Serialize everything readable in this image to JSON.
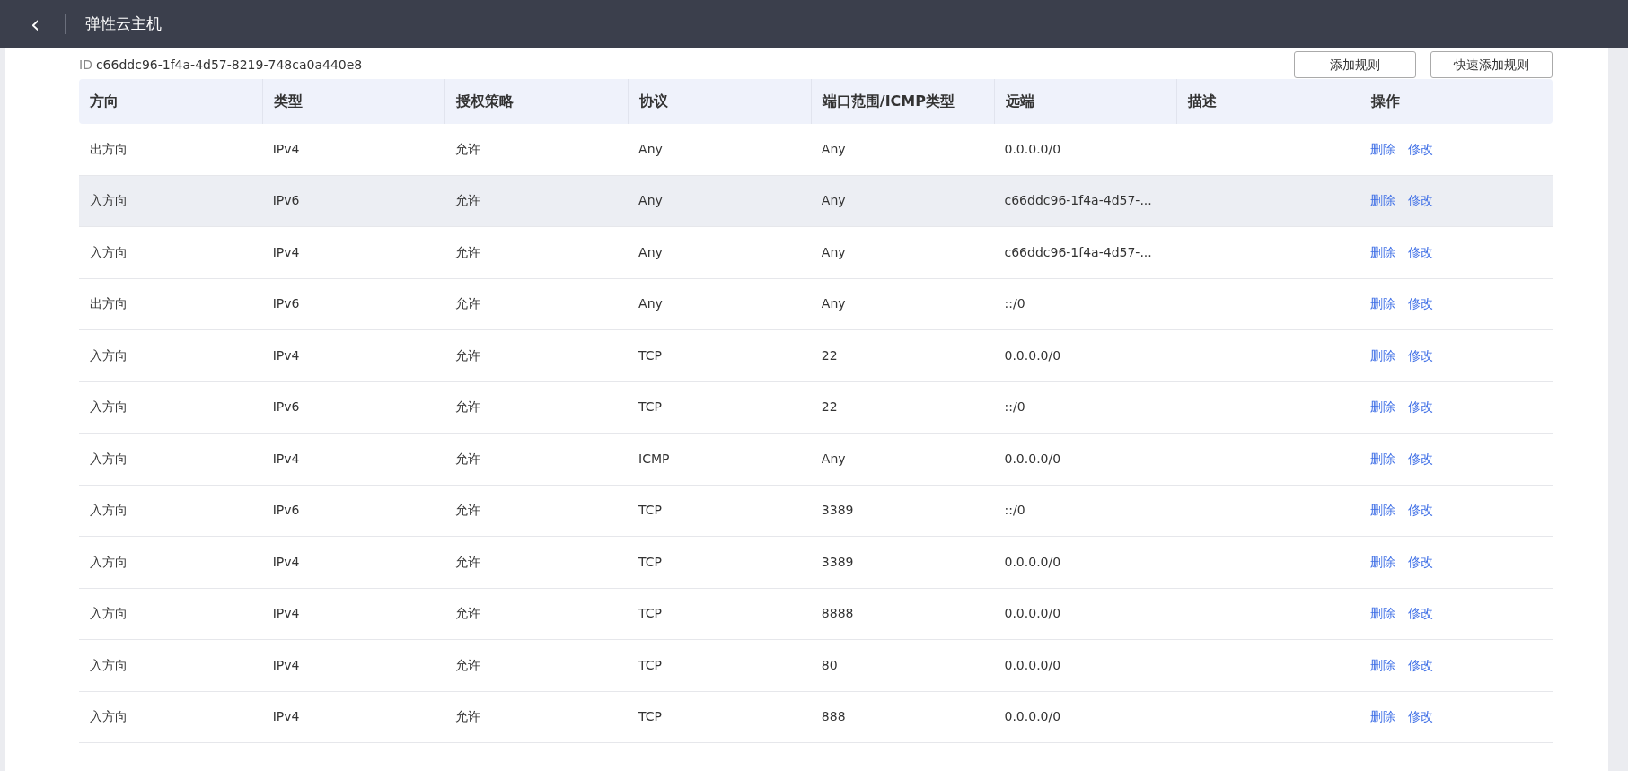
{
  "header": {
    "back": "‹",
    "title": "弹性云主机"
  },
  "id": {
    "label": "ID",
    "value": "c66ddc96-1f4a-4d57-8219-748ca0a440e8"
  },
  "buttons": [
    "添加规则",
    "快速添加规则"
  ],
  "table": {
    "columns": [
      "方向",
      "类型",
      "授权策略",
      "协议",
      "端口范围/ICMP类型",
      "远端",
      "描述",
      "操作"
    ],
    "rows": [
      {
        "cells": [
          "出方向",
          "IPv4",
          "允许",
          "Any",
          "Any",
          "0.0.0.0/0",
          ""
        ],
        "actions": [
          "删除",
          "修改"
        ],
        "highlighted": false
      },
      {
        "cells": [
          "入方向",
          "IPv6",
          "允许",
          "Any",
          "Any",
          "c66ddc96-1f4a-4d57-...",
          ""
        ],
        "actions": [
          "删除",
          "修改"
        ],
        "highlighted": true
      },
      {
        "cells": [
          "入方向",
          "IPv4",
          "允许",
          "Any",
          "Any",
          "c66ddc96-1f4a-4d57-...",
          ""
        ],
        "actions": [
          "删除",
          "修改"
        ],
        "highlighted": false
      },
      {
        "cells": [
          "出方向",
          "IPv6",
          "允许",
          "Any",
          "Any",
          "::/0",
          ""
        ],
        "actions": [
          "删除",
          "修改"
        ],
        "highlighted": false
      },
      {
        "cells": [
          "入方向",
          "IPv4",
          "允许",
          "TCP",
          "22",
          "0.0.0.0/0",
          ""
        ],
        "actions": [
          "删除",
          "修改"
        ],
        "highlighted": false
      },
      {
        "cells": [
          "入方向",
          "IPv6",
          "允许",
          "TCP",
          "22",
          "::/0",
          ""
        ],
        "actions": [
          "删除",
          "修改"
        ],
        "highlighted": false
      },
      {
        "cells": [
          "入方向",
          "IPv4",
          "允许",
          "ICMP",
          "Any",
          "0.0.0.0/0",
          ""
        ],
        "actions": [
          "删除",
          "修改"
        ],
        "highlighted": false
      },
      {
        "cells": [
          "入方向",
          "IPv6",
          "允许",
          "TCP",
          "3389",
          "::/0",
          ""
        ],
        "actions": [
          "删除",
          "修改"
        ],
        "highlighted": false
      },
      {
        "cells": [
          "入方向",
          "IPv4",
          "允许",
          "TCP",
          "3389",
          "0.0.0.0/0",
          ""
        ],
        "actions": [
          "删除",
          "修改"
        ],
        "highlighted": false
      },
      {
        "cells": [
          "入方向",
          "IPv4",
          "允许",
          "TCP",
          "8888",
          "0.0.0.0/0",
          ""
        ],
        "actions": [
          "删除",
          "修改"
        ],
        "highlighted": false
      },
      {
        "cells": [
          "入方向",
          "IPv4",
          "允许",
          "TCP",
          "80",
          "0.0.0.0/0",
          ""
        ],
        "actions": [
          "删除",
          "修改"
        ],
        "highlighted": false
      },
      {
        "cells": [
          "入方向",
          "IPv4",
          "允许",
          "TCP",
          "888",
          "0.0.0.0/0",
          ""
        ],
        "actions": [
          "删除",
          "修改"
        ],
        "highlighted": false
      }
    ]
  }
}
